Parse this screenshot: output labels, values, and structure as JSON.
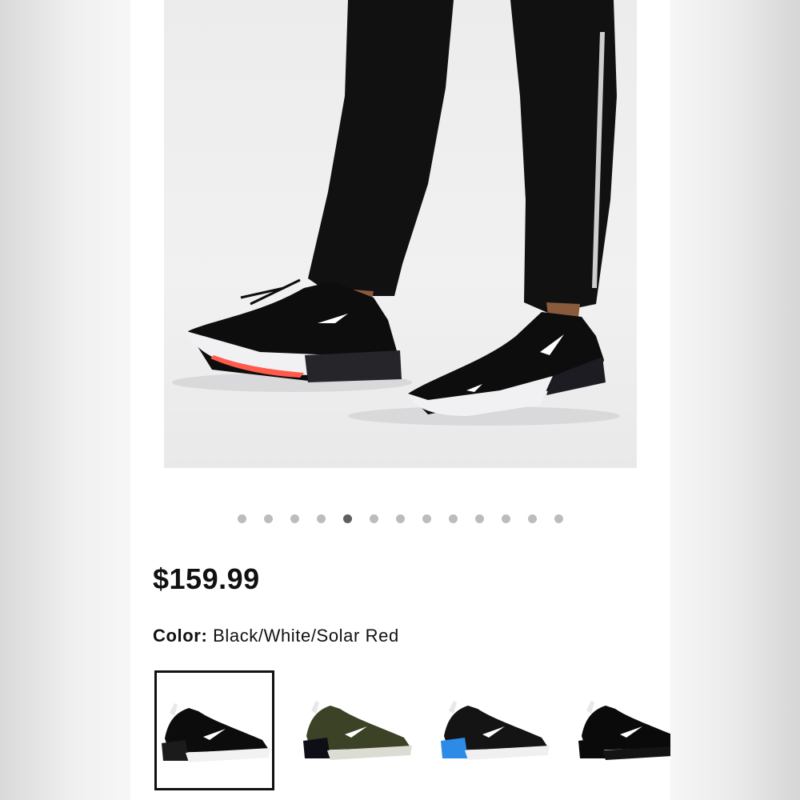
{
  "product": {
    "hero_image": "model-legs-wearing-black-sneakers",
    "carousel": {
      "total": 13,
      "active_index": 4
    },
    "price": "$159.99",
    "color_label": "Color:",
    "color_value": "Black/White/Solar Red",
    "swatches": [
      {
        "name": "Black/White/Solar Red",
        "upper": "#0c0c0c",
        "sole": "#f2f2f2",
        "heel": "#1b1b1b",
        "selected": true
      },
      {
        "name": "Olive",
        "upper": "#3b4226",
        "sole": "#dcdcd4",
        "heel": "#0e0e16",
        "selected": false
      },
      {
        "name": "Blue",
        "upper": "#141414",
        "sole": "#f0f0f0",
        "heel": "#2c8be6",
        "selected": false
      },
      {
        "name": "Triple Black",
        "upper": "#0a0a0a",
        "sole": "#141414",
        "heel": "#0a0a0a",
        "selected": false
      }
    ]
  }
}
